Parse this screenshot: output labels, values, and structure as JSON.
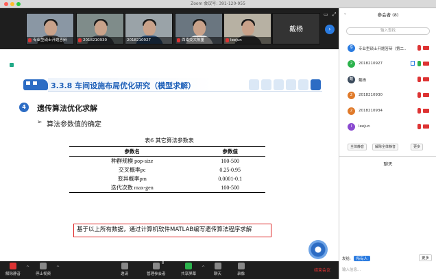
{
  "window": {
    "title": "Zoom 会议号: 391-120-955"
  },
  "videos": [
    {
      "name": "专业型硕士开题答辩",
      "shirt": "#2b2b2b",
      "bg": "#8a97a4"
    },
    {
      "name": "2018210930",
      "shirt": "#3b3f46",
      "bg": "#7f8c8a"
    },
    {
      "name": "2018210927",
      "shirt": "#2c4a6e",
      "bg": "#9aa3a8"
    },
    {
      "name": "西南交大陈董",
      "shirt": "#e8e8e8",
      "bg": "#6a7680"
    },
    {
      "name": "leejun",
      "shirt": "#3a3a3a",
      "bg": "#b7b1a3"
    },
    {
      "name": "戴杨"
    }
  ],
  "slide": {
    "section_title": "3.3.8 车间设施布局优化研究（模型求解）",
    "number": "4",
    "heading": "遗传算法优化求解",
    "subheading": "算法参数值的确定",
    "table_caption": "表6 其它算法参数表",
    "table": {
      "headers": [
        "参数名",
        "参数值"
      ],
      "rows": [
        [
          "种群规模 pop-size",
          "100-500"
        ],
        [
          "交叉概率pc",
          "0.25-0.95"
        ],
        [
          "变异概率pm",
          "0.0001-0.1"
        ],
        [
          "迭代次数 max-gen",
          "100-500"
        ]
      ]
    },
    "conclusion": "基于以上所有数据，通过计算机软件MATLAB编写遗传算法程序求解"
  },
  "toolbar": {
    "unmute": "解除静音",
    "stop_video": "停止视频",
    "invite": "邀请",
    "manage": "管理参会者",
    "participant_count": "8",
    "share": "共享屏幕",
    "chat": "聊天",
    "record": "录像",
    "end": "结束会议"
  },
  "panel": {
    "title": "参会者 (8)",
    "search_placeholder": "输入查找",
    "participants": [
      {
        "avatar": "专",
        "name": "专业型硕士开题答辩（第二...",
        "color": "#2a7be0",
        "mic": "off",
        "cam": true,
        "share": false
      },
      {
        "avatar": "2",
        "name": "2018210927",
        "color": "#2bb24c",
        "mic": "on",
        "cam": true,
        "share": true
      },
      {
        "avatar": "戴",
        "name": "戴杨",
        "color": "#3b4a5c",
        "mic": "off",
        "cam": true,
        "share": false
      },
      {
        "avatar": "2",
        "name": "2018210930",
        "color": "#e07a2a",
        "mic": "off",
        "cam": true,
        "share": false
      },
      {
        "avatar": "2",
        "name": "2018210934",
        "color": "#e07a2a",
        "mic": "off",
        "cam": true,
        "share": false
      },
      {
        "avatar": "l",
        "name": "leejun",
        "color": "#8a4ad0",
        "mic": "off",
        "cam": true,
        "share": false
      }
    ],
    "mute_all": "全体静音",
    "unmute_all": "解除全体静音",
    "more": "更多",
    "chat_title": "聊天",
    "send_to_label": "发给:",
    "send_to_value": "所有人",
    "chat_more": "更多",
    "chat_placeholder": "输入信息..."
  },
  "colors": {
    "accent": "#2c6cc4",
    "alert": "#d22222",
    "toolbar_bg": "#1e1e1e"
  }
}
